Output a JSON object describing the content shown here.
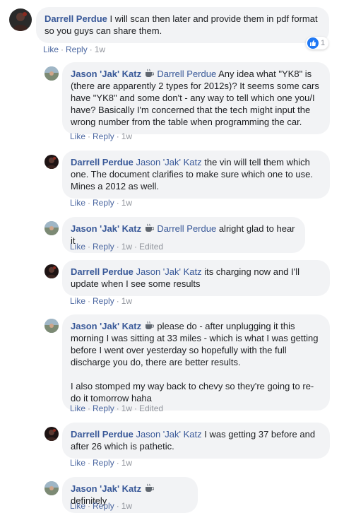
{
  "comment": {
    "author": "Darrell Perdue",
    "text": "I will scan then later and provide them in pdf format so you guys can share them.",
    "like": "Like",
    "reply": "Reply",
    "time": "1w",
    "reaction_count": "1",
    "like_color": "#2078f4"
  },
  "replies": [
    {
      "author": "Jason 'Jak' Katz",
      "badge": "coffee-icon",
      "tag": "Darrell Perdue",
      "paragraphs": [
        "Any idea what \"YK8\" is (there are apparently 2 types for 2012s)? It seems some cars have \"YK8\" and some don't - any way to tell which one you/I have? Basically I'm concerned that the tech might input the wrong number from the table when programming the car."
      ],
      "like": "Like",
      "reply": "Reply",
      "time": "1w",
      "edited": ""
    },
    {
      "author": "Darrell Perdue",
      "badge": "",
      "tag": "Jason 'Jak' Katz",
      "paragraphs": [
        "the vin will tell them which one. The document clarifies to make sure which one to use. Mines a 2012 as well."
      ],
      "like": "Like",
      "reply": "Reply",
      "time": "1w",
      "edited": ""
    },
    {
      "author": "Jason 'Jak' Katz",
      "badge": "coffee-icon",
      "tag": "Darrell Perdue",
      "paragraphs": [
        "alright glad to hear it"
      ],
      "like": "Like",
      "reply": "Reply",
      "time": "1w",
      "edited": "Edited"
    },
    {
      "author": "Darrell Perdue",
      "badge": "",
      "tag": "Jason 'Jak' Katz",
      "paragraphs": [
        "its charging now and I'll update when I see some results"
      ],
      "like": "Like",
      "reply": "Reply",
      "time": "1w",
      "edited": ""
    },
    {
      "author": "Jason 'Jak' Katz",
      "badge": "coffee-icon",
      "tag": "",
      "paragraphs": [
        "please do - after unplugging it this morning I was sitting at 33 miles - which is what I was getting before I went over yesterday so hopefully with the full discharge you do, there are better results.",
        "I also stomped my way back to chevy so they're going to re-do it tomorrow haha"
      ],
      "like": "Like",
      "reply": "Reply",
      "time": "1w",
      "edited": "Edited"
    },
    {
      "author": "Darrell Perdue",
      "badge": "",
      "tag": "Jason 'Jak' Katz",
      "paragraphs": [
        "I was getting 37 before and after 26 which is pathetic."
      ],
      "like": "Like",
      "reply": "Reply",
      "time": "1w",
      "edited": ""
    },
    {
      "author": "Jason 'Jak' Katz",
      "badge": "coffee-icon",
      "tag": "",
      "paragraphs": [
        "definitely"
      ],
      "like": "Like",
      "reply": "Reply",
      "time": "1w",
      "edited": ""
    }
  ]
}
